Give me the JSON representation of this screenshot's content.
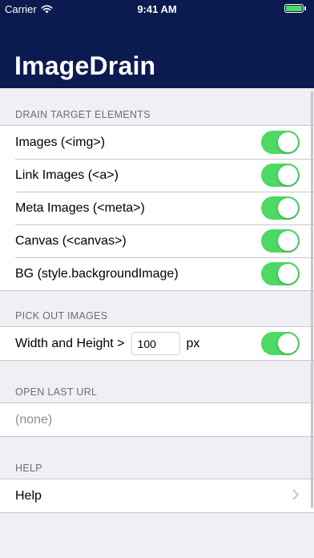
{
  "status_bar": {
    "carrier": "Carrier",
    "time": "9:41 AM",
    "battery_percent": 100
  },
  "nav": {
    "title": "ImageDrain"
  },
  "sections": {
    "drain": {
      "header": "DRAIN TARGET ELEMENTS",
      "items": [
        {
          "label": "Images (<img>)",
          "on": true
        },
        {
          "label": "Link Images (<a>)",
          "on": true
        },
        {
          "label": "Meta Images (<meta>)",
          "on": true
        },
        {
          "label": "Canvas (<canvas>)",
          "on": true
        },
        {
          "label": "BG (style.backgroundImage)",
          "on": true
        }
      ]
    },
    "pick": {
      "header": "PICK OUT IMAGES",
      "label": "Width and Height >",
      "value": "100",
      "unit": "px",
      "on": true
    },
    "open_last": {
      "header": "OPEN LAST URL",
      "value": "(none)"
    },
    "help": {
      "header": "HELP",
      "item": "Help"
    }
  },
  "icons": {
    "wifi": "wifi-icon",
    "battery": "battery-icon",
    "chevron": "chevron-right-icon"
  },
  "colors": {
    "nav_background": "#0b1a4f",
    "toggle_on": "#4cd964",
    "page_background": "#efeff4",
    "section_header_text": "#6d6d72"
  }
}
